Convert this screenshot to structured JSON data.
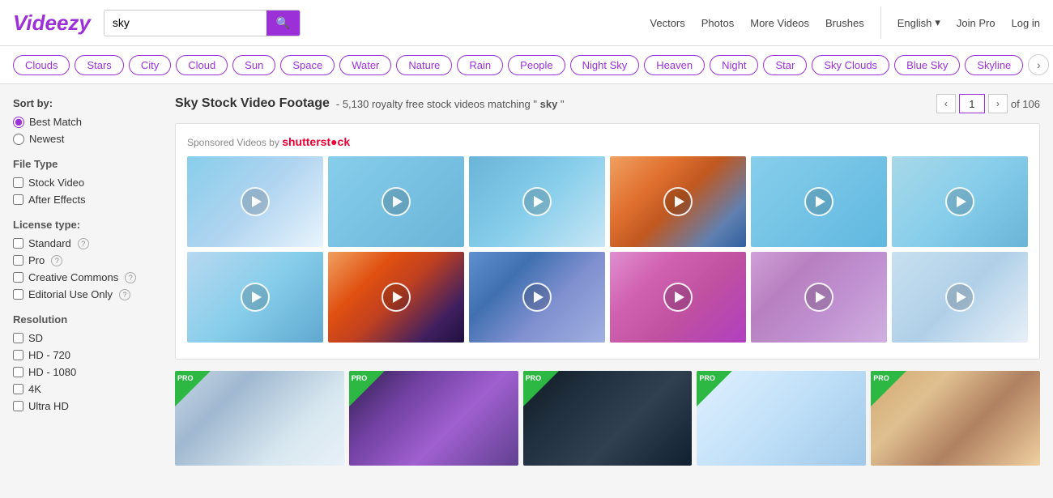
{
  "header": {
    "logo": "Videezy",
    "search": {
      "value": "sky",
      "placeholder": "sky"
    },
    "nav": {
      "vectors": "Vectors",
      "photos": "Photos",
      "moreVideos": "More Videos",
      "brushes": "Brushes",
      "language": "English",
      "joinPro": "Join Pro",
      "login": "Log in"
    }
  },
  "tags": {
    "items": [
      "Clouds",
      "Stars",
      "City",
      "Cloud",
      "Sun",
      "Space",
      "Water",
      "Nature",
      "Rain",
      "People",
      "Night Sky",
      "Heaven",
      "Night",
      "Star",
      "Sky Clouds",
      "Blue Sky",
      "Skyline"
    ],
    "arrowLabel": "›"
  },
  "sidebar": {
    "sortBy": "Sort by:",
    "sortOptions": [
      {
        "label": "Best Match",
        "value": "best",
        "checked": true
      },
      {
        "label": "Newest",
        "value": "newest",
        "checked": false
      }
    ],
    "fileType": "File Type",
    "fileOptions": [
      {
        "label": "Stock Video",
        "checked": false
      },
      {
        "label": "After Effects",
        "checked": false
      }
    ],
    "licenseType": "License type:",
    "licenseOptions": [
      {
        "label": "Standard",
        "hasHelp": true,
        "checked": false
      },
      {
        "label": "Pro",
        "hasHelp": true,
        "checked": false
      },
      {
        "label": "Creative Commons",
        "hasHelp": true,
        "checked": false
      },
      {
        "label": "Editorial Use Only",
        "hasHelp": true,
        "checked": false
      }
    ],
    "resolution": "Resolution",
    "resOptions": [
      {
        "label": "SD",
        "checked": false
      },
      {
        "label": "HD - 720",
        "checked": false
      },
      {
        "label": "HD - 1080",
        "checked": false
      },
      {
        "label": "4K",
        "checked": false
      },
      {
        "label": "Ultra HD",
        "checked": false
      }
    ]
  },
  "results": {
    "title": "Sky Stock Video Footage",
    "countText": "- 5,130 royalty free stock videos matching \"",
    "query": "sky",
    "queryClose": "\"",
    "page": "1",
    "totalPages": "of 106"
  },
  "sponsored": {
    "label": "Sponsored Videos by",
    "brand": "shutterstock"
  }
}
